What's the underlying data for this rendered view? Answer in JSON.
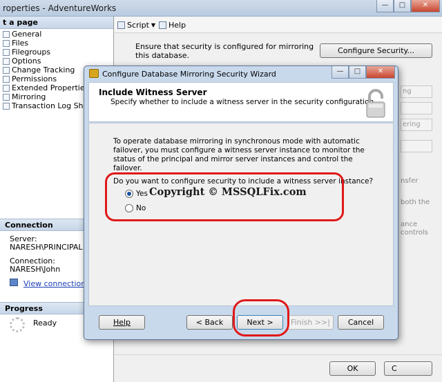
{
  "bg_window": {
    "title": "roperties - AdventureWorks",
    "left_pane": {
      "header": "t a page",
      "pages": [
        "General",
        "Files",
        "Filegroups",
        "Options",
        "Change Tracking",
        "Permissions",
        "Extended Properties",
        "Mirroring",
        "Transaction Log Shipping"
      ]
    },
    "connection": {
      "header": "Connection",
      "server_label": "Server:",
      "server_value": "NARESH\\PRINCIPAL",
      "connection_label": "Connection:",
      "connection_value": "NARESH\\John",
      "view_link": "View connection properties"
    },
    "progress": {
      "header": "Progress",
      "status": "Ready"
    },
    "toolbar": {
      "script_label": "Script",
      "help_label": "Help"
    },
    "ensure_text": "Ensure that security is configured for mirroring this database.",
    "configure_security_button": "Configure Security...",
    "ghost_fields": [
      "ng",
      "",
      "ering",
      ""
    ],
    "ghost_texts": [
      "nsfer",
      "both the",
      "ance",
      "controls"
    ],
    "ok_button": "OK",
    "cancel_button": "C"
  },
  "dialog": {
    "title": "Configure Database Mirroring Security Wizard",
    "header_title": "Include Witness Server",
    "header_subtitle": "Specify whether to include a witness server in the security configuration.",
    "description": "To operate database mirroring in synchronous mode with automatic failover, you must configure a witness server instance to monitor the status of the principal and mirror server instances and control the failover.",
    "question": "Do you want to configure security to include a witness server instance?",
    "options": [
      {
        "label": "Yes",
        "selected": true
      },
      {
        "label": "No",
        "selected": false
      }
    ],
    "watermark": "Copyright ©  MSSQLFix.com",
    "buttons": {
      "help": "Help",
      "back": "< Back",
      "next": "Next >",
      "finish": "Finish >>|",
      "cancel": "Cancel"
    }
  },
  "colors": {
    "highlight_oval": "#e01818",
    "dialog_frame": "#c9d9ec"
  }
}
